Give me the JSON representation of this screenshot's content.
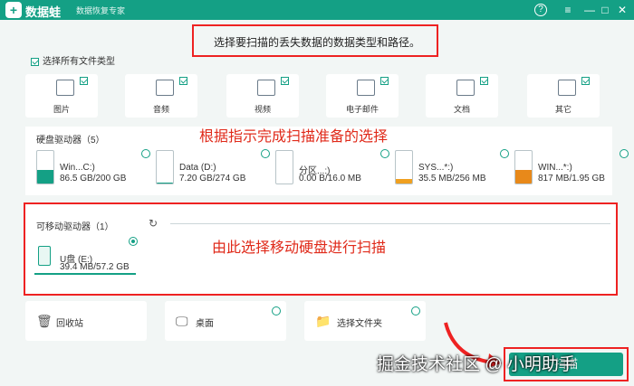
{
  "titlebar": {
    "logo": "+",
    "app_name": "数据蛙",
    "subtitle": "数据恢复专家",
    "help": "?",
    "menu": "≡",
    "minimize": "—",
    "maximize": "□",
    "close": "✕"
  },
  "instruction": "选择要扫描的丢失数据的数据类型和路径。",
  "select_all_label": "选择所有文件类型",
  "file_types": [
    {
      "label": "图片",
      "icon": "image-icon",
      "checked": true
    },
    {
      "label": "音频",
      "icon": "audio-icon",
      "checked": true
    },
    {
      "label": "视频",
      "icon": "video-icon",
      "checked": true
    },
    {
      "label": "电子邮件",
      "icon": "email-icon",
      "checked": true
    },
    {
      "label": "文档",
      "icon": "document-icon",
      "checked": true
    },
    {
      "label": "其它",
      "icon": "other-icon",
      "checked": true
    }
  ],
  "hard_drives": {
    "title": "硬盘驱动器（5）",
    "items": [
      {
        "name": "Win...C:)",
        "size": "86.5 GB/200 GB",
        "fill": 0.43,
        "color": "#14a085"
      },
      {
        "name": "Data (D:)",
        "size": "7.20 GB/274 GB",
        "fill": 0.03,
        "color": "#14a085"
      },
      {
        "name": "分区...:)",
        "size": "0.00  B/16.0 MB",
        "fill": 0.0,
        "color": "#14a085"
      },
      {
        "name": "SYS...*:)",
        "size": "35.5 MB/256 MB",
        "fill": 0.14,
        "color": "#f0a020"
      },
      {
        "name": "WIN...*:)",
        "size": "817 MB/1.95 GB",
        "fill": 0.42,
        "color": "#e8891a"
      }
    ]
  },
  "callout_mid": "根据指示完成扫描准备的选择",
  "removable": {
    "title": "可移动驱动器（1）",
    "refresh_icon": "↻",
    "callout": "由此选择移动硬盘进行扫描",
    "items": [
      {
        "name": "U盘 (E:)",
        "size": "39.4 MB/57.2 GB",
        "selected": true
      }
    ]
  },
  "locations": [
    {
      "label": "回收站",
      "icon": "recycle-bin-icon",
      "glyph": "🗑"
    },
    {
      "label": "桌面",
      "icon": "desktop-icon",
      "glyph": "🖵"
    },
    {
      "label": "选择文件夹",
      "icon": "folder-icon",
      "glyph": "📁"
    }
  ],
  "scan_button": "扫描",
  "watermark": "掘金技术社区 @ 小明助手"
}
